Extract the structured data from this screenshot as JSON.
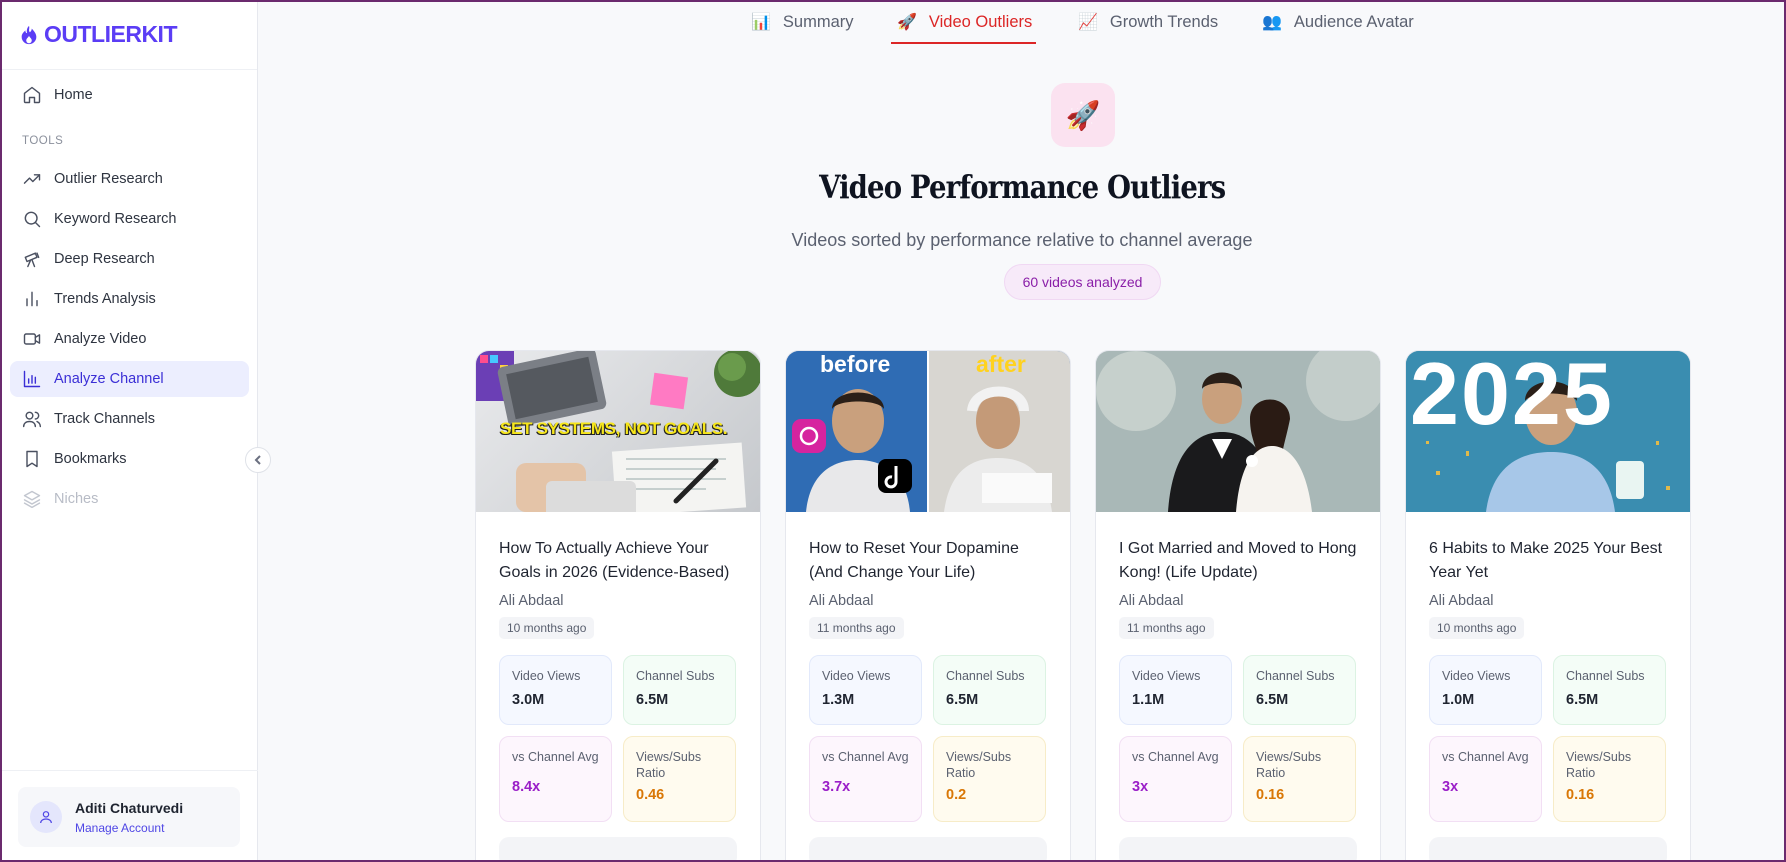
{
  "brand": {
    "name": "OUTLIERKIT",
    "accent": "#5b3df5"
  },
  "sidebar": {
    "home_label": "Home",
    "section_label": "TOOLS",
    "items": [
      {
        "label": "Outlier Research",
        "icon": "trending-up-icon"
      },
      {
        "label": "Keyword Research",
        "icon": "search-icon"
      },
      {
        "label": "Deep Research",
        "icon": "telescope-icon"
      },
      {
        "label": "Trends Analysis",
        "icon": "bar-chart-icon"
      },
      {
        "label": "Analyze Video",
        "icon": "video-icon"
      },
      {
        "label": "Analyze Channel",
        "icon": "chart-bars-icon",
        "active": true
      },
      {
        "label": "Track Channels",
        "icon": "users-icon"
      },
      {
        "label": "Bookmarks",
        "icon": "bookmark-icon"
      },
      {
        "label": "Niches",
        "icon": "layers-icon",
        "disabled": true
      }
    ],
    "account": {
      "name": "Aditi Chaturvedi",
      "link": "Manage Account"
    }
  },
  "tabs": [
    {
      "label": "Summary",
      "icon": "📊"
    },
    {
      "label": "Video Outliers",
      "icon": "🚀",
      "active": true
    },
    {
      "label": "Growth Trends",
      "icon": "📈"
    },
    {
      "label": "Audience Avatar",
      "icon": "👥"
    }
  ],
  "hero": {
    "icon": "🚀",
    "title": "Video Performance Outliers",
    "subtitle": "Videos sorted by performance relative to channel average",
    "badge": "60 videos analyzed"
  },
  "stat_labels": {
    "views": "Video Views",
    "subs": "Channel Subs",
    "avg": "vs Channel Avg",
    "ratio": "Views/Subs Ratio"
  },
  "cards": [
    {
      "title": "How To Actually Achieve Your Goals in 2026 (Evidence-Based)",
      "channel": "Ali Abdaal",
      "time": "10 months ago",
      "thumb_text": "SET SYSTEMS, NOT GOALS.",
      "views": "3.0M",
      "subs": "6.5M",
      "avg": "8.4x",
      "ratio": "0.46"
    },
    {
      "title": "How to Reset Your Dopamine (And Change Your Life)",
      "channel": "Ali Abdaal",
      "time": "11 months ago",
      "thumb_left": "before",
      "thumb_right": "after",
      "views": "1.3M",
      "subs": "6.5M",
      "avg": "3.7x",
      "ratio": "0.2"
    },
    {
      "title": "I Got Married and Moved to Hong Kong! (Life Update)",
      "channel": "Ali Abdaal",
      "time": "11 months ago",
      "views": "1.1M",
      "subs": "6.5M",
      "avg": "3x",
      "ratio": "0.16"
    },
    {
      "title": "6 Habits to Make 2025 Your Best Year Yet",
      "channel": "Ali Abdaal",
      "time": "10 months ago",
      "thumb_text": "2025",
      "views": "1.0M",
      "subs": "6.5M",
      "avg": "3x",
      "ratio": "0.16"
    }
  ]
}
